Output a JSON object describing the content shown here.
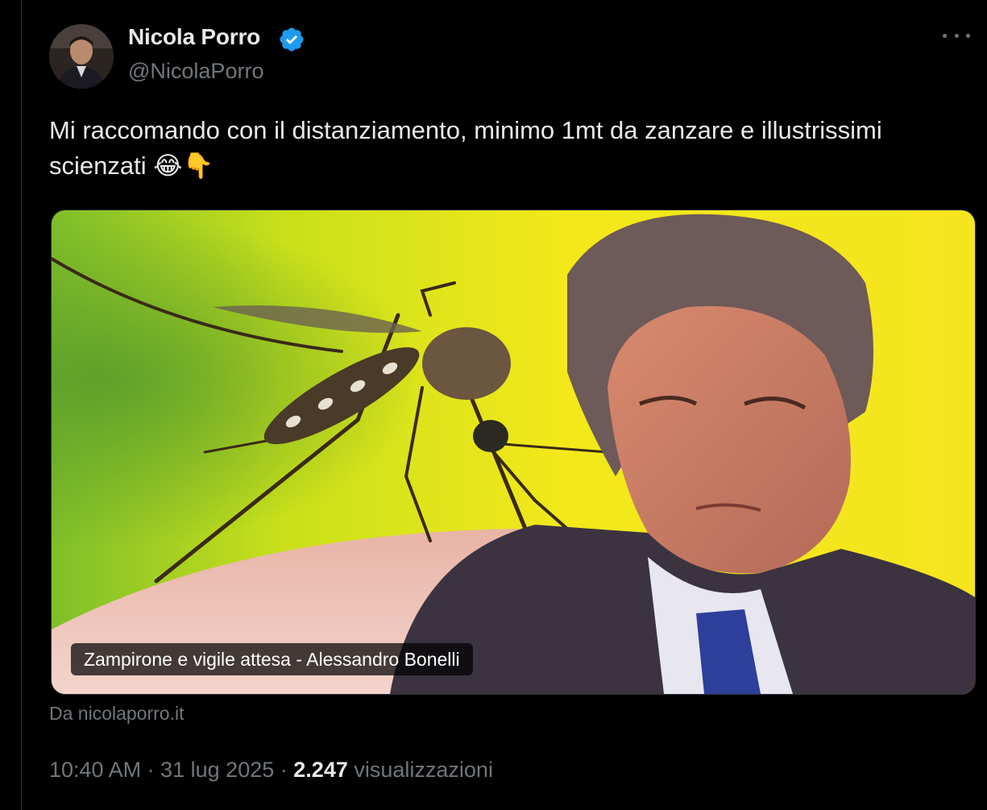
{
  "author": {
    "display_name": "Nicola Porro",
    "handle": "@NicolaPorro",
    "verified_color": "#1d9bf0"
  },
  "tweet": {
    "text": "Mi raccomando con il distanziamento, minimo 1mt da zanzare e illustrissimi scienzati 😂👇"
  },
  "link_card": {
    "title": "Zampirone e vigile attesa - Alessandro Bonelli",
    "source": "Da nicolaporro.it"
  },
  "meta": {
    "time": "10:40 AM",
    "separator": "·",
    "date": "31 lug 2025",
    "views_count": "2.247",
    "views_label": "visualizzazioni"
  },
  "icons": {
    "more": "more-horizontal-icon",
    "verified": "verified-badge-icon"
  },
  "colors": {
    "background": "#000000",
    "text": "#e7e9ea",
    "secondary_text": "#71767b",
    "border": "#2f3336"
  }
}
